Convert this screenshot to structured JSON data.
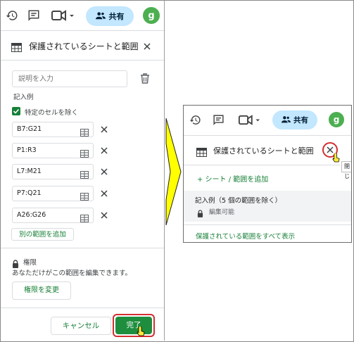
{
  "toolbar": {
    "share_label": "共有",
    "avatar_initial": "g",
    "icons": [
      "history-icon",
      "comment-icon",
      "video-call-icon",
      "people-icon"
    ]
  },
  "left_panel": {
    "title": "保護されているシートと範囲",
    "description_placeholder": "説明を入力",
    "sample_label": "記入例",
    "exclude_cells_label": "特定のセルを除く",
    "excluded_ranges": [
      "B7:G21",
      "P1:R3",
      "L7:M21",
      "P7:Q21",
      "A26:G26"
    ],
    "add_range_label": "別の範囲を追加",
    "permission_heading": "権限",
    "permission_desc": "あなただけがこの範囲を編集できます。",
    "change_permission_label": "権限を変更",
    "cancel_label": "キャンセル",
    "done_label": "完了"
  },
  "right_panel": {
    "share_label": "共有",
    "avatar_initial": "g",
    "title": "保護されているシートと範囲",
    "tooltip": "閉じ",
    "add_sheet_range_label": "+ シート / 範囲を追加",
    "item_title": "記入例（5 個の範囲を除く）",
    "item_permission": "編集可能",
    "show_all_label": "保護されている範囲をすべて表示"
  },
  "colors": {
    "accent_green": "#188038",
    "done_green": "#1e8e3e",
    "share_blue": "#c2e7ff",
    "highlight_red": "#d32f2f",
    "arrow_yellow": "#ffff00"
  }
}
